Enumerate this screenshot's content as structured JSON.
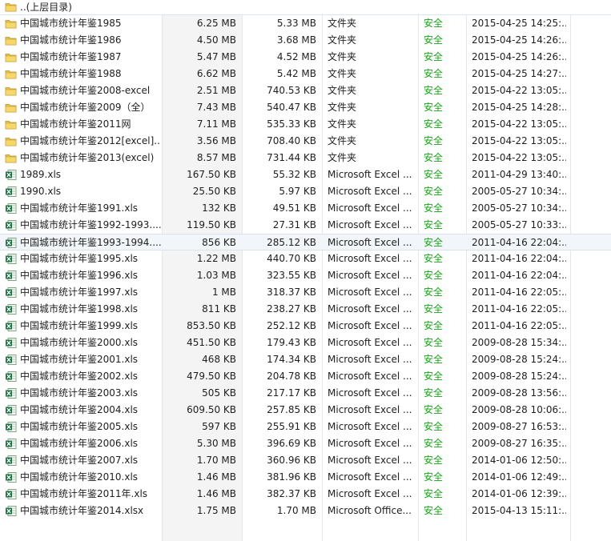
{
  "parent_row": {
    "label": "..(上层目录)",
    "icon": "folder-icon"
  },
  "security_color": "#1aa21a",
  "rows": [
    {
      "name": "中国城市统计年鉴1985",
      "size": "6.25 MB",
      "compressed": "5.33 MB",
      "type": "文件夹",
      "security": "安全",
      "modified": "2015-04-25 14:25:...",
      "icon": "folder-icon"
    },
    {
      "name": "中国城市统计年鉴1986",
      "size": "4.50 MB",
      "compressed": "3.68 MB",
      "type": "文件夹",
      "security": "安全",
      "modified": "2015-04-25 14:26:...",
      "icon": "folder-icon"
    },
    {
      "name": "中国城市统计年鉴1987",
      "size": "5.47 MB",
      "compressed": "4.52 MB",
      "type": "文件夹",
      "security": "安全",
      "modified": "2015-04-25 14:26:...",
      "icon": "folder-icon"
    },
    {
      "name": "中国城市统计年鉴1988",
      "size": "6.62 MB",
      "compressed": "5.42 MB",
      "type": "文件夹",
      "security": "安全",
      "modified": "2015-04-25 14:27:...",
      "icon": "folder-icon"
    },
    {
      "name": "中国城市统计年鉴2008-excel",
      "size": "2.51 MB",
      "compressed": "740.53 KB",
      "type": "文件夹",
      "security": "安全",
      "modified": "2015-04-22 13:05:...",
      "icon": "folder-icon"
    },
    {
      "name": "中国城市统计年鉴2009（全）",
      "size": "7.43 MB",
      "compressed": "540.47 KB",
      "type": "文件夹",
      "security": "安全",
      "modified": "2015-04-25 14:28:...",
      "icon": "folder-icon"
    },
    {
      "name": "中国城市统计年鉴2011网",
      "size": "7.11 MB",
      "compressed": "535.33 KB",
      "type": "文件夹",
      "security": "安全",
      "modified": "2015-04-22 13:05:...",
      "icon": "folder-icon"
    },
    {
      "name": "中国城市统计年鉴2012[excel]...",
      "size": "3.56 MB",
      "compressed": "708.40 KB",
      "type": "文件夹",
      "security": "安全",
      "modified": "2015-04-22 13:05:...",
      "icon": "folder-icon"
    },
    {
      "name": "中国城市统计年鉴2013(excel)",
      "size": "8.57 MB",
      "compressed": "731.44 KB",
      "type": "文件夹",
      "security": "安全",
      "modified": "2015-04-22 13:05:...",
      "icon": "folder-icon"
    },
    {
      "name": "1989.xls",
      "size": "167.50 KB",
      "compressed": "55.32 KB",
      "type": "Microsoft Excel ...",
      "security": "安全",
      "modified": "2011-04-29 13:40:...",
      "icon": "excel-file-icon"
    },
    {
      "name": "1990.xls",
      "size": "25.50 KB",
      "compressed": "5.97 KB",
      "type": "Microsoft Excel ...",
      "security": "安全",
      "modified": "2005-05-27 10:34:...",
      "icon": "excel-file-icon"
    },
    {
      "name": "中国城市统计年鉴1991.xls",
      "size": "132 KB",
      "compressed": "49.51 KB",
      "type": "Microsoft Excel ...",
      "security": "安全",
      "modified": "2005-05-27 10:34:...",
      "icon": "excel-file-icon"
    },
    {
      "name": "中国城市统计年鉴1992-1993....",
      "size": "119.50 KB",
      "compressed": "27.31 KB",
      "type": "Microsoft Excel ...",
      "security": "安全",
      "modified": "2005-05-27 10:33:...",
      "icon": "excel-file-icon"
    },
    {
      "name": "中国城市统计年鉴1993-1994....",
      "size": "856 KB",
      "compressed": "285.12 KB",
      "type": "Microsoft Excel ...",
      "security": "安全",
      "modified": "2011-04-16 22:04:...",
      "icon": "excel-file-icon",
      "selected": true
    },
    {
      "name": "中国城市统计年鉴1995.xls",
      "size": "1.22 MB",
      "compressed": "440.70 KB",
      "type": "Microsoft Excel ...",
      "security": "安全",
      "modified": "2011-04-16 22:04:...",
      "icon": "excel-file-icon"
    },
    {
      "name": "中国城市统计年鉴1996.xls",
      "size": "1.03 MB",
      "compressed": "323.55 KB",
      "type": "Microsoft Excel ...",
      "security": "安全",
      "modified": "2011-04-16 22:04:...",
      "icon": "excel-file-icon"
    },
    {
      "name": "中国城市统计年鉴1997.xls",
      "size": "1 MB",
      "compressed": "318.37 KB",
      "type": "Microsoft Excel ...",
      "security": "安全",
      "modified": "2011-04-16 22:05:...",
      "icon": "excel-file-icon"
    },
    {
      "name": "中国城市统计年鉴1998.xls",
      "size": "811 KB",
      "compressed": "238.27 KB",
      "type": "Microsoft Excel ...",
      "security": "安全",
      "modified": "2011-04-16 22:05:...",
      "icon": "excel-file-icon"
    },
    {
      "name": "中国城市统计年鉴1999.xls",
      "size": "853.50 KB",
      "compressed": "252.12 KB",
      "type": "Microsoft Excel ...",
      "security": "安全",
      "modified": "2011-04-16 22:05:...",
      "icon": "excel-file-icon"
    },
    {
      "name": "中国城市统计年鉴2000.xls",
      "size": "451.50 KB",
      "compressed": "179.43 KB",
      "type": "Microsoft Excel ...",
      "security": "安全",
      "modified": "2009-08-28 15:34:...",
      "icon": "excel-file-icon"
    },
    {
      "name": "中国城市统计年鉴2001.xls",
      "size": "468 KB",
      "compressed": "174.34 KB",
      "type": "Microsoft Excel ...",
      "security": "安全",
      "modified": "2009-08-28 15:24:...",
      "icon": "excel-file-icon"
    },
    {
      "name": "中国城市统计年鉴2002.xls",
      "size": "479.50 KB",
      "compressed": "204.78 KB",
      "type": "Microsoft Excel ...",
      "security": "安全",
      "modified": "2009-08-28 15:24:...",
      "icon": "excel-file-icon"
    },
    {
      "name": "中国城市统计年鉴2003.xls",
      "size": "505 KB",
      "compressed": "217.17 KB",
      "type": "Microsoft Excel ...",
      "security": "安全",
      "modified": "2009-08-28 13:56:...",
      "icon": "excel-file-icon"
    },
    {
      "name": "中国城市统计年鉴2004.xls",
      "size": "609.50 KB",
      "compressed": "257.85 KB",
      "type": "Microsoft Excel ...",
      "security": "安全",
      "modified": "2009-08-28 10:06:...",
      "icon": "excel-file-icon"
    },
    {
      "name": "中国城市统计年鉴2005.xls",
      "size": "597 KB",
      "compressed": "255.91 KB",
      "type": "Microsoft Excel ...",
      "security": "安全",
      "modified": "2009-08-27 16:53:...",
      "icon": "excel-file-icon"
    },
    {
      "name": "中国城市统计年鉴2006.xls",
      "size": "5.30 MB",
      "compressed": "396.69 KB",
      "type": "Microsoft Excel ...",
      "security": "安全",
      "modified": "2009-08-27 16:35:...",
      "icon": "excel-file-icon"
    },
    {
      "name": "中国城市统计年鉴2007.xls",
      "size": "1.70 MB",
      "compressed": "360.96 KB",
      "type": "Microsoft Excel ...",
      "security": "安全",
      "modified": "2014-01-06 12:50:...",
      "icon": "excel-file-icon"
    },
    {
      "name": "中国城市统计年鉴2010.xls",
      "size": "1.46 MB",
      "compressed": "381.96 KB",
      "type": "Microsoft Excel ...",
      "security": "安全",
      "modified": "2014-01-06 12:49:...",
      "icon": "excel-file-icon"
    },
    {
      "name": "中国城市统计年鉴2011年.xls",
      "size": "1.46 MB",
      "compressed": "382.37 KB",
      "type": "Microsoft Excel ...",
      "security": "安全",
      "modified": "2014-01-06 12:39:...",
      "icon": "excel-file-icon"
    },
    {
      "name": "中国城市统计年鉴2014.xlsx",
      "size": "1.75 MB",
      "compressed": "1.70 MB",
      "type": "Microsoft Office...",
      "security": "安全",
      "modified": "2015-04-13 15:11:...",
      "icon": "excel-file-icon"
    }
  ]
}
